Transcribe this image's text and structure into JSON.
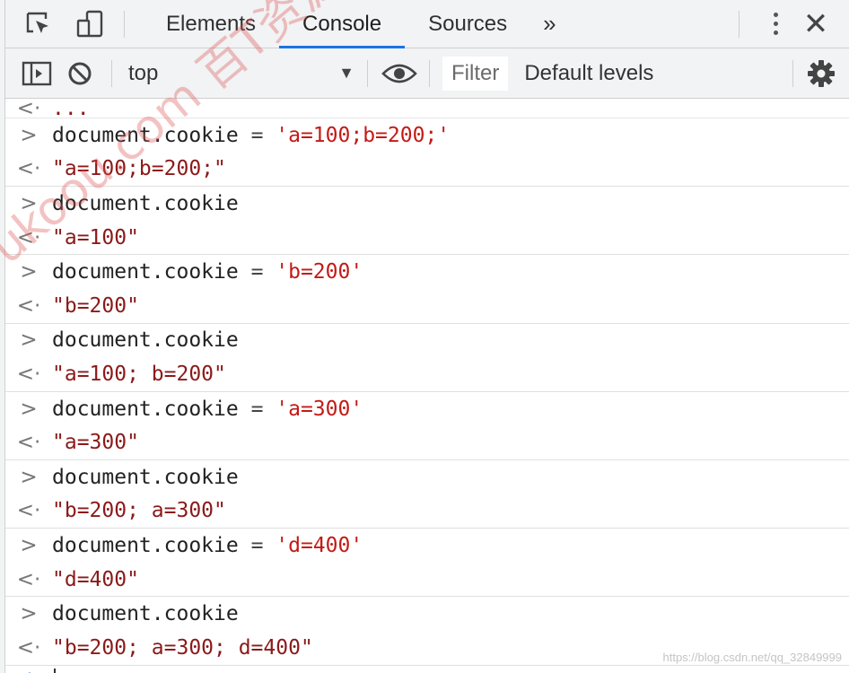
{
  "devtools": {
    "tabs": [
      {
        "label": "Elements"
      },
      {
        "label": "Console"
      },
      {
        "label": "Sources"
      }
    ],
    "more_tabs": "»",
    "close": "✕"
  },
  "toolbar": {
    "context": "top",
    "filter_placeholder": "Filter",
    "levels_label": "Default levels"
  },
  "console": {
    "first_out": "...",
    "entries": [
      {
        "input_parts": [
          [
            "document.cookie",
            "plain"
          ],
          [
            " = ",
            "op"
          ],
          [
            "'a=100;b=200;'",
            "str"
          ]
        ],
        "output": "\"a=100;b=200;\""
      },
      {
        "input_parts": [
          [
            "document.cookie",
            "plain"
          ]
        ],
        "output": "\"a=100\""
      },
      {
        "input_parts": [
          [
            "document.cookie",
            "plain"
          ],
          [
            " = ",
            "op"
          ],
          [
            "'b=200'",
            "str"
          ]
        ],
        "output": "\"b=200\""
      },
      {
        "input_parts": [
          [
            "document.cookie",
            "plain"
          ]
        ],
        "output": "\"a=100; b=200\""
      },
      {
        "input_parts": [
          [
            "document.cookie",
            "plain"
          ],
          [
            " = ",
            "op"
          ],
          [
            "'a=300'",
            "str"
          ]
        ],
        "output": "\"a=300\""
      },
      {
        "input_parts": [
          [
            "document.cookie",
            "plain"
          ]
        ],
        "output": "\"b=200; a=300\""
      },
      {
        "input_parts": [
          [
            "document.cookie",
            "plain"
          ],
          [
            " = ",
            "op"
          ],
          [
            "'d=400'",
            "str"
          ]
        ],
        "output": "\"d=400\""
      },
      {
        "input_parts": [
          [
            "document.cookie",
            "plain"
          ]
        ],
        "output": "\"b=200; a=300; d=400\""
      }
    ]
  },
  "overlay": {
    "watermark": "ukoou.com 百T资源随心下",
    "credit": "https://blog.csdn.net/qq_32849999"
  },
  "colors": {
    "accent": "#1a73e8",
    "string": "#c41a16",
    "output": "#8b1a1a"
  }
}
